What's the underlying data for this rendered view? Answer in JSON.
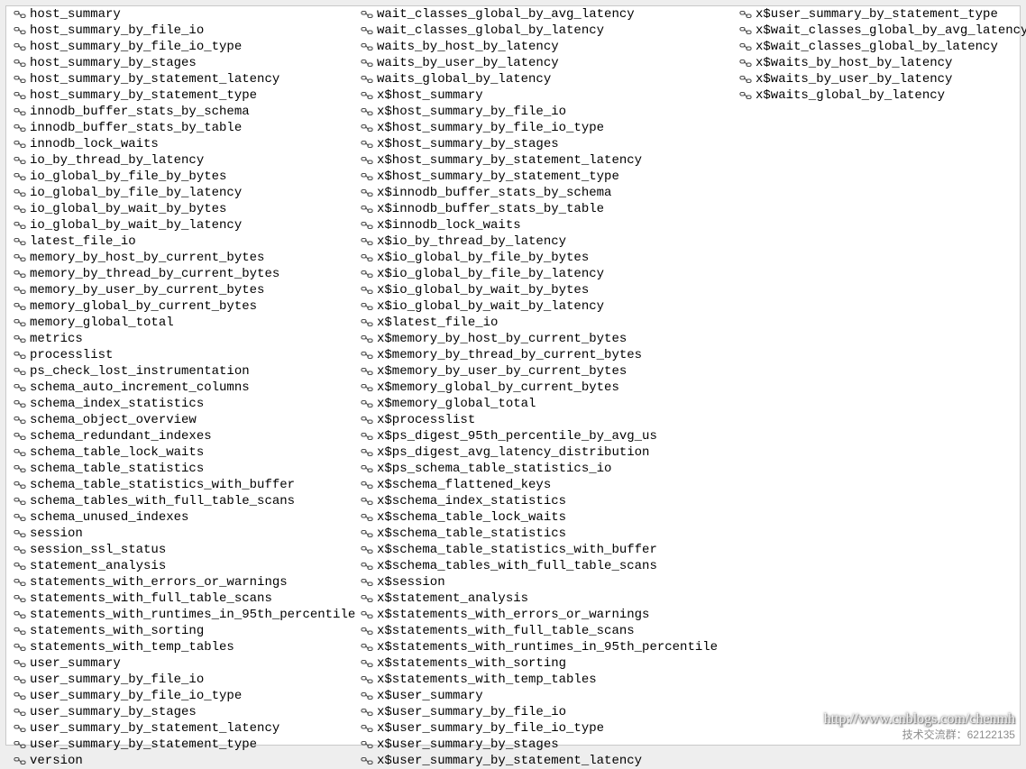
{
  "watermark_url": "http://www.cnblogs.com/chenmh",
  "watermark_group": "技术交流群：62122135",
  "columns": [
    [
      "host_summary",
      "host_summary_by_file_io",
      "host_summary_by_file_io_type",
      "host_summary_by_stages",
      "host_summary_by_statement_latency",
      "host_summary_by_statement_type",
      "innodb_buffer_stats_by_schema",
      "innodb_buffer_stats_by_table",
      "innodb_lock_waits",
      "io_by_thread_by_latency",
      "io_global_by_file_by_bytes",
      "io_global_by_file_by_latency",
      "io_global_by_wait_by_bytes",
      "io_global_by_wait_by_latency",
      "latest_file_io",
      "memory_by_host_by_current_bytes",
      "memory_by_thread_by_current_bytes",
      "memory_by_user_by_current_bytes",
      "memory_global_by_current_bytes",
      "memory_global_total",
      "metrics",
      "processlist",
      "ps_check_lost_instrumentation",
      "schema_auto_increment_columns",
      "schema_index_statistics",
      "schema_object_overview",
      "schema_redundant_indexes",
      "schema_table_lock_waits",
      "schema_table_statistics",
      "schema_table_statistics_with_buffer",
      "schema_tables_with_full_table_scans",
      "schema_unused_indexes",
      "session",
      "session_ssl_status",
      "statement_analysis",
      "statements_with_errors_or_warnings",
      "statements_with_full_table_scans",
      "statements_with_runtimes_in_95th_percentile",
      "statements_with_sorting",
      "statements_with_temp_tables",
      "user_summary",
      "user_summary_by_file_io",
      "user_summary_by_file_io_type",
      "user_summary_by_stages",
      "user_summary_by_statement_latency",
      "user_summary_by_statement_type",
      "version"
    ],
    [
      "wait_classes_global_by_avg_latency",
      "wait_classes_global_by_latency",
      "waits_by_host_by_latency",
      "waits_by_user_by_latency",
      "waits_global_by_latency",
      "x$host_summary",
      "x$host_summary_by_file_io",
      "x$host_summary_by_file_io_type",
      "x$host_summary_by_stages",
      "x$host_summary_by_statement_latency",
      "x$host_summary_by_statement_type",
      "x$innodb_buffer_stats_by_schema",
      "x$innodb_buffer_stats_by_table",
      "x$innodb_lock_waits",
      "x$io_by_thread_by_latency",
      "x$io_global_by_file_by_bytes",
      "x$io_global_by_file_by_latency",
      "x$io_global_by_wait_by_bytes",
      "x$io_global_by_wait_by_latency",
      "x$latest_file_io",
      "x$memory_by_host_by_current_bytes",
      "x$memory_by_thread_by_current_bytes",
      "x$memory_by_user_by_current_bytes",
      "x$memory_global_by_current_bytes",
      "x$memory_global_total",
      "x$processlist",
      "x$ps_digest_95th_percentile_by_avg_us",
      "x$ps_digest_avg_latency_distribution",
      "x$ps_schema_table_statistics_io",
      "x$schema_flattened_keys",
      "x$schema_index_statistics",
      "x$schema_table_lock_waits",
      "x$schema_table_statistics",
      "x$schema_table_statistics_with_buffer",
      "x$schema_tables_with_full_table_scans",
      "x$session",
      "x$statement_analysis",
      "x$statements_with_errors_or_warnings",
      "x$statements_with_full_table_scans",
      "x$statements_with_runtimes_in_95th_percentile",
      "x$statements_with_sorting",
      "x$statements_with_temp_tables",
      "x$user_summary",
      "x$user_summary_by_file_io",
      "x$user_summary_by_file_io_type",
      "x$user_summary_by_stages",
      "x$user_summary_by_statement_latency"
    ],
    [
      "x$user_summary_by_statement_type",
      "x$wait_classes_global_by_avg_latency",
      "x$wait_classes_global_by_latency",
      "x$waits_by_host_by_latency",
      "x$waits_by_user_by_latency",
      "x$waits_global_by_latency"
    ]
  ]
}
